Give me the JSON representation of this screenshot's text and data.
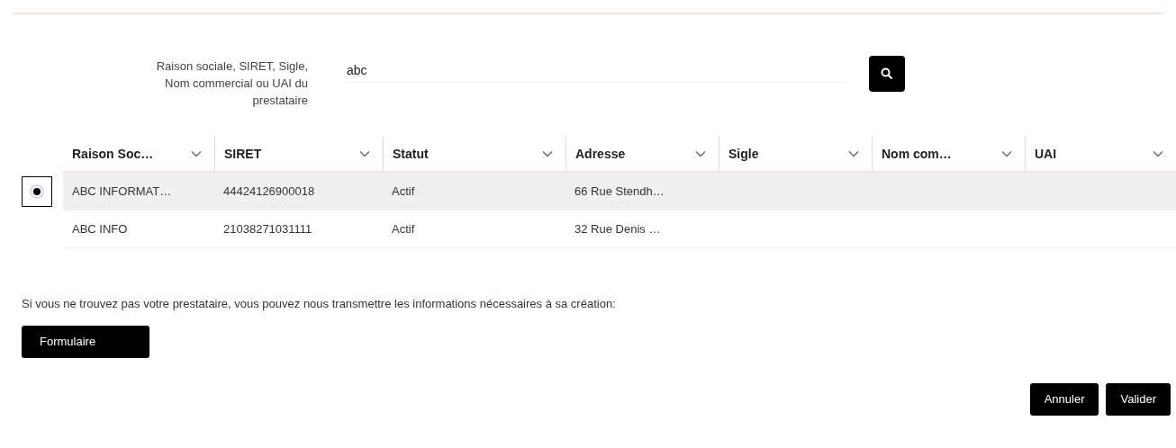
{
  "search": {
    "label": "Raison sociale, SIRET, Sigle, Nom commercial ou UAI du prestataire",
    "value": "abc"
  },
  "table": {
    "columns": [
      "Raison Soc…",
      "SIRET",
      "Statut",
      "Adresse",
      "Sigle",
      "Nom com…",
      "UAI"
    ],
    "rows": [
      {
        "selected": true,
        "cells": [
          "ABC INFORMAT…",
          "44424126900018",
          "Actif",
          "66 Rue Stendh…",
          "",
          "",
          ""
        ]
      },
      {
        "selected": false,
        "cells": [
          "ABC INFO",
          "21038271031111",
          "Actif",
          "32 Rue Denis …",
          "",
          "",
          ""
        ]
      }
    ]
  },
  "notice": "Si vous ne trouvez pas votre prestataire, vous pouvez nous transmettre les informations nécessaires à sa création:",
  "form_button": "Formulaire",
  "buttons": [
    "Annuler",
    "Valider"
  ]
}
